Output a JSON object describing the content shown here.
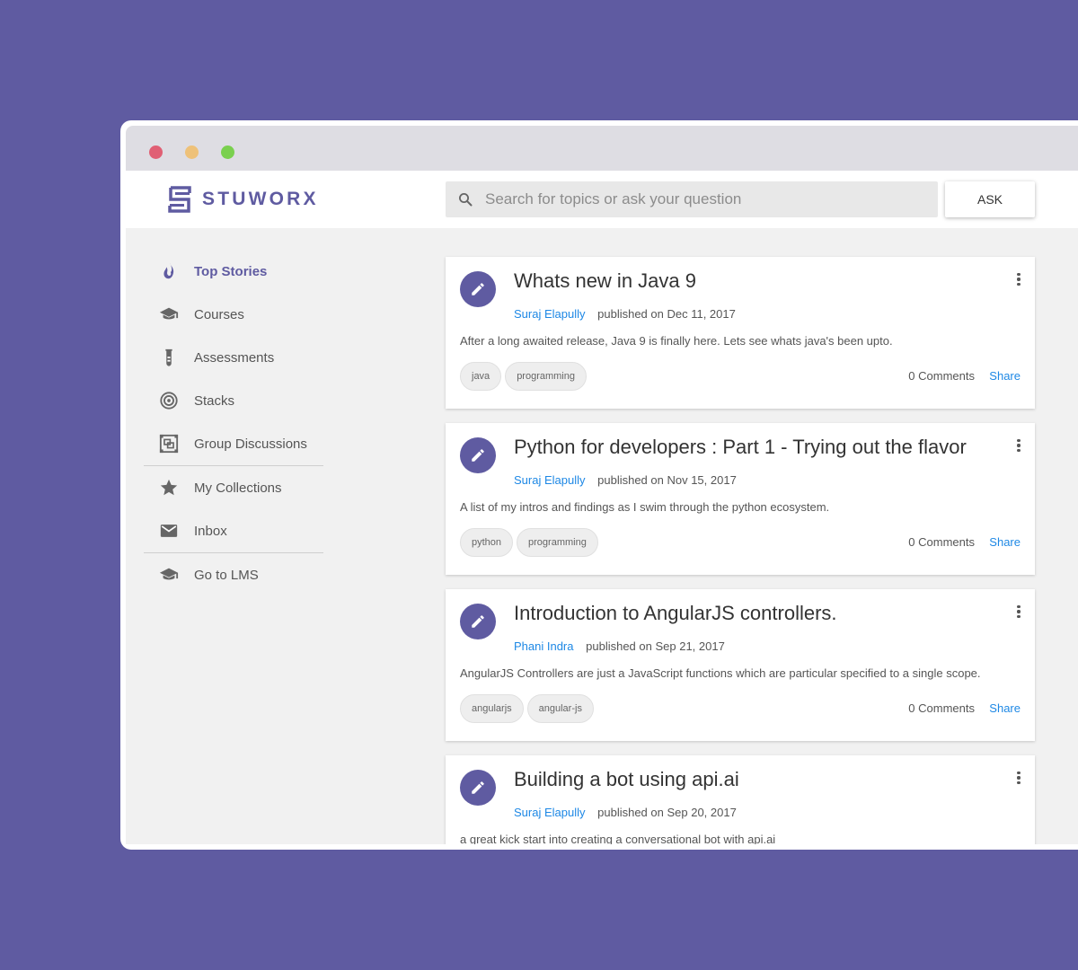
{
  "brand": {
    "name": "STUWORX",
    "accent": "#5f5ba1",
    "link_color": "#1e88e5"
  },
  "search": {
    "placeholder": "Search for topics or ask your question",
    "value": ""
  },
  "ask_label": "ASK",
  "sidebar": {
    "items": [
      {
        "label": "Top Stories",
        "icon": "flame-icon",
        "active": true
      },
      {
        "label": "Courses",
        "icon": "graduation-cap-icon"
      },
      {
        "label": "Assessments",
        "icon": "test-tube-icon"
      },
      {
        "label": "Stacks",
        "icon": "target-icon"
      },
      {
        "label": "Group Discussions",
        "icon": "group-frame-icon"
      },
      {
        "label": "My Collections",
        "icon": "star-icon"
      },
      {
        "label": "Inbox",
        "icon": "mail-icon"
      },
      {
        "label": "Go to LMS",
        "icon": "graduation-cap-icon"
      }
    ]
  },
  "posts": [
    {
      "title": "Whats new in Java 9",
      "author": "Suraj Elapully",
      "published": "published on Dec 11, 2017",
      "excerpt": "After a long awaited release, Java 9 is finally here. Lets see whats java's been upto.",
      "tags": [
        "java",
        "programming"
      ],
      "comments": "0 Comments",
      "share": "Share"
    },
    {
      "title": "Python for developers : Part 1 - Trying out the flavor",
      "author": "Suraj Elapully",
      "published": "published on Nov 15, 2017",
      "excerpt": "A list of my intros and findings as I swim through the python ecosystem.",
      "tags": [
        "python",
        "programming"
      ],
      "comments": "0 Comments",
      "share": "Share"
    },
    {
      "title": "Introduction to AngularJS controllers.",
      "author": "Phani Indra",
      "published": "published on Sep 21, 2017",
      "excerpt": "AngularJS Controllers are just a JavaScript functions which are particular specified to a single scope.",
      "tags": [
        "angularjs",
        "angular-js"
      ],
      "comments": "0 Comments",
      "share": "Share"
    },
    {
      "title": "Building a bot using api.ai",
      "author": "Suraj Elapully",
      "published": "published on Sep 20, 2017",
      "excerpt": "a great kick start into creating a conversational bot with api.ai",
      "tags": [],
      "comments": "",
      "share": ""
    }
  ]
}
